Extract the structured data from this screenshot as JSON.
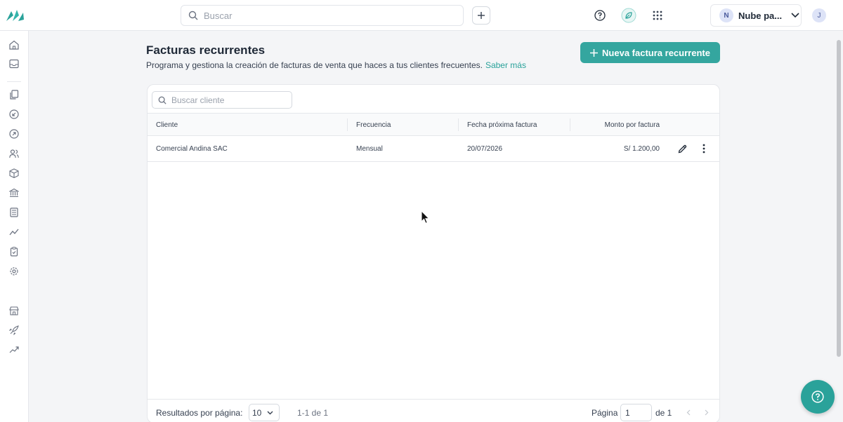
{
  "topbar": {
    "search_placeholder": "Buscar",
    "company_initial": "N",
    "company_name": "Nube pa...",
    "user_initial": "J"
  },
  "header": {
    "title": "Facturas recurrentes",
    "description": "Programa y gestiona la creación de facturas de venta que haces a tus clientes frecuentes.",
    "learn_more": "Saber más",
    "new_button": "Nueva factura recurrente"
  },
  "table": {
    "search_placeholder": "Buscar cliente",
    "columns": [
      "Cliente",
      "Frecuencia",
      "Fecha próxima factura",
      "Monto por factura"
    ],
    "rows": [
      {
        "cliente": "Comercial Andina SAC",
        "frecuencia": "Mensual",
        "fecha": "20/07/2026",
        "monto": "S/ 1.200,00"
      }
    ]
  },
  "pagination": {
    "per_page_label": "Resultados por página:",
    "per_page_value": "10",
    "range": "1-1 de 1",
    "page_label": "Página",
    "page_value": "1",
    "page_total": "de 1"
  },
  "colors": {
    "accent": "#34a69f",
    "link": "#2aa29a"
  }
}
